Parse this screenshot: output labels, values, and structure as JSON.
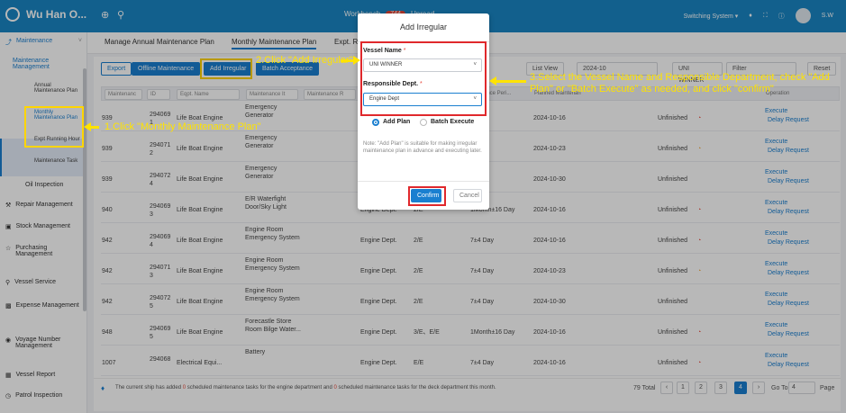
{
  "app": {
    "name": "Wu Han O...",
    "title": "Workbench",
    "title_badge": "744",
    "top_item2": "Unread..."
  },
  "topbar": {
    "switching": "Switching System",
    "user": "S.W"
  },
  "sidebar": {
    "maintenance": "Maintenance",
    "maintenance_mgmt": "Maintenance Management",
    "leaf_annual": "Annual Maintenance Plan",
    "leaf_monthly": "Monthly Maintenance Plan",
    "leaf_expt": "Expt Running Hour",
    "leaf_task": "Maintenance Task",
    "oil": "Oil Inspection",
    "repair": "Repair Management",
    "stock": "Stock Management",
    "purchasing": "Purchasing Management",
    "vessel_service": "Vessel Service",
    "expense": "Expense Management",
    "voyage": "Voyage Number Management",
    "vessel_report": "Vessel Report",
    "patrol": "Patrol Inspection"
  },
  "tabs": [
    "Manage Annual Maintenance Plan",
    "Monthly Maintenance Plan",
    "Expt. R..."
  ],
  "toolbar": {
    "export": "Export",
    "offline": "Offline Maintenance",
    "add_irregular": "Add Irregular",
    "batch": "Batch Acceptance",
    "view": "List View",
    "month": "2024-10",
    "vessel": "UNI WINNER",
    "filter": "Filter",
    "reset": "Reset"
  },
  "table": {
    "headers": [
      "Maintenanc",
      "ID",
      "Eqpt. Name",
      "Maintenance It",
      "Maintenance R",
      "ance Peri...",
      "Planned Maintenan",
      "Operation"
    ],
    "rows": [
      {
        "c1": "939",
        "id": "294069 1",
        "eq": "Life Boat Engine",
        "item": "Emergency Generator",
        "dept": "",
        "role": "",
        "period": "...y",
        "date": "2024-10-16",
        "status": "Unfinished",
        "sc": "red"
      },
      {
        "c1": "939",
        "id": "294071 2",
        "eq": "Life Boat Engine",
        "item": "Emergency Generator",
        "dept": "",
        "role": "",
        "period": "...y",
        "date": "2024-10-23",
        "status": "Unfinished",
        "sc": "org"
      },
      {
        "c1": "939",
        "id": "294072 4",
        "eq": "Life Boat Engine",
        "item": "Emergency Generator",
        "dept": "",
        "role": "",
        "period": "...y",
        "date": "2024-10-30",
        "status": "Unfinished",
        "sc": ""
      },
      {
        "c1": "940",
        "id": "294069 3",
        "eq": "Life Boat Engine",
        "item": "E/R Waterfight Door/Sky Light",
        "dept": "Engine Dept.",
        "role": "2/E",
        "period": "1Month±16 Day",
        "date": "2024-10-16",
        "status": "Unfinished",
        "sc": "red"
      },
      {
        "c1": "942",
        "id": "294069 4",
        "eq": "Life Boat Engine",
        "item": "Engine Room Emergency System",
        "dept": "Engine Dept.",
        "role": "2/E",
        "period": "7±4 Day",
        "date": "2024-10-16",
        "status": "Unfinished",
        "sc": "red"
      },
      {
        "c1": "942",
        "id": "294071 3",
        "eq": "Life Boat Engine",
        "item": "Engine Room Emergency System",
        "dept": "Engine Dept.",
        "role": "2/E",
        "period": "7±4 Day",
        "date": "2024-10-23",
        "status": "Unfinished",
        "sc": "org"
      },
      {
        "c1": "942",
        "id": "294072 5",
        "eq": "Life Boat Engine",
        "item": "Engine Room Emergency System",
        "dept": "Engine Dept.",
        "role": "2/E",
        "period": "7±4 Day",
        "date": "2024-10-30",
        "status": "Unfinished",
        "sc": ""
      },
      {
        "c1": "948",
        "id": "294069 5",
        "eq": "Life Boat Engine",
        "item": "Forecastle Store Room Bilge Water...",
        "dept": "Engine Dept.",
        "role": "3/E、E/E",
        "period": "1Month±16 Day",
        "date": "2024-10-16",
        "status": "Unfinished",
        "sc": "red"
      },
      {
        "c1": "1007",
        "id": "294068",
        "eq": "Electrical Equi...",
        "item": "Battery",
        "dept": "Engine Dept.",
        "role": "E/E",
        "period": "7±4 Day",
        "date": "2024-10-16",
        "status": "Unfinished",
        "sc": "red"
      }
    ],
    "op_execute": "Execute",
    "op_delay": "Delay Request"
  },
  "footer": {
    "msg_a": "The current ship has added ",
    "msg_n1": "0",
    "msg_b": " scheduled maintenance tasks for the engine department and ",
    "msg_n2": "0",
    "msg_c": " scheduled maintenance tasks for the deck department this month.",
    "total": "79 Total",
    "pages": [
      "1",
      "2",
      "3",
      "4"
    ],
    "goto": "Go To",
    "goto_val": "4",
    "page_word": "Page"
  },
  "modal": {
    "title": "Add Irregular",
    "vessel_label": "Vessel Name",
    "vessel_value": "UNI WINNER",
    "dept_label": "Responsible Dept.",
    "dept_value": "Engine Dept",
    "add_plan": "Add Plan",
    "batch_execute": "Batch Execute",
    "note": "Note: \"Add Plan\" is suitable for making irregular maintenance plan in advance and executing later.",
    "confirm": "Confirm",
    "cancel": "Cancel"
  },
  "annotations": {
    "a1": "1.Click \"Monthly Maintenance Plan\"",
    "a2": "2.Click \"Add Irregular\"",
    "a3": "3.Select the Vessel Name and Responsible Department, check \"Add Plan\" or \"Batch Execute\" as needed, and click \"confirm\""
  }
}
